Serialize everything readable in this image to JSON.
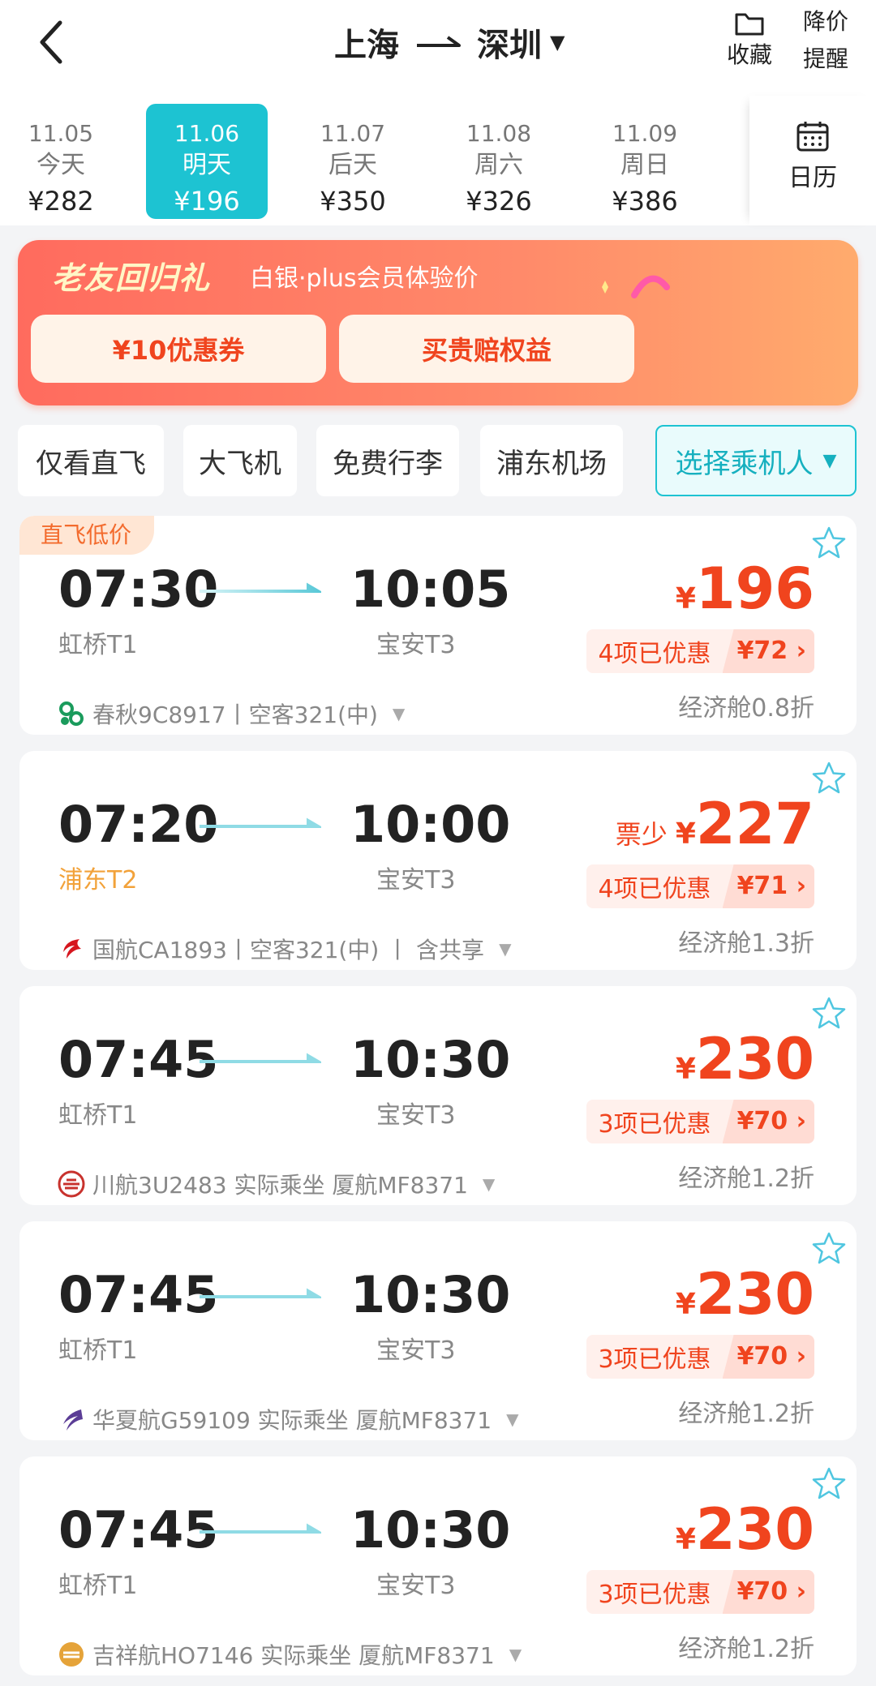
{
  "header": {
    "origin": "上海",
    "destination": "深圳",
    "favorite_label": "收藏",
    "alert_label_line1": "降价",
    "alert_label_line2": "提醒"
  },
  "dates": [
    {
      "date": "11.05",
      "label": "今天",
      "price": "¥282"
    },
    {
      "date": "11.06",
      "label": "明天",
      "price": "¥196"
    },
    {
      "date": "11.07",
      "label": "后天",
      "price": "¥350"
    },
    {
      "date": "11.08",
      "label": "周六",
      "price": "¥326"
    },
    {
      "date": "11.09",
      "label": "周日",
      "price": "¥386"
    }
  ],
  "selected_date_index": 1,
  "calendar_label": "日历",
  "promo": {
    "title": "老友回归礼",
    "subtitle": "白银·plus会员体验价",
    "coupon_label": "¥10优惠券",
    "benefit_label": "买贵赔权益"
  },
  "filters": {
    "nonstop": "仅看直飞",
    "big_plane": "大飞机",
    "free_baggage": "免费行李",
    "pudong": "浦东机场",
    "passenger": "选择乘机人"
  },
  "flights": [
    {
      "tag": "直飞低价",
      "dep_time": "07:30",
      "arr_time": "10:05",
      "dep_airport": "虹桥T1",
      "arr_airport": "宝安T3",
      "airline": "春秋9C8917丨空客321(中)",
      "note": "",
      "yen": "¥",
      "price": "196",
      "discount_label": "4项已优惠",
      "discount_value": "¥72",
      "cabin": "经济舱0.8折"
    },
    {
      "tag": "",
      "dep_time": "07:20",
      "arr_time": "10:00",
      "dep_airport": "浦东T2",
      "arr_airport": "宝安T3",
      "airline": "国航CA1893丨空客321(中) 丨 含共享",
      "note": "票少",
      "yen": "¥",
      "price": "227",
      "discount_label": "4项已优惠",
      "discount_value": "¥71",
      "cabin": "经济舱1.3折"
    },
    {
      "tag": "",
      "dep_time": "07:45",
      "arr_time": "10:30",
      "dep_airport": "虹桥T1",
      "arr_airport": "宝安T3",
      "airline": "川航3U2483 实际乘坐 厦航MF8371",
      "note": "",
      "yen": "¥",
      "price": "230",
      "discount_label": "3项已优惠",
      "discount_value": "¥70",
      "cabin": "经济舱1.2折"
    },
    {
      "tag": "",
      "dep_time": "07:45",
      "arr_time": "10:30",
      "dep_airport": "虹桥T1",
      "arr_airport": "宝安T3",
      "airline": "华夏航G59109 实际乘坐 厦航MF8371",
      "note": "",
      "yen": "¥",
      "price": "230",
      "discount_label": "3项已优惠",
      "discount_value": "¥70",
      "cabin": "经济舱1.2折"
    },
    {
      "tag": "",
      "dep_time": "07:45",
      "arr_time": "10:30",
      "dep_airport": "虹桥T1",
      "arr_airport": "宝安T3",
      "airline": "吉祥航HO7146 实际乘坐 厦航MF8371",
      "note": "",
      "yen": "¥",
      "price": "230",
      "discount_label": "3项已优惠",
      "discount_value": "¥70",
      "cabin": "经济舱1.2折"
    }
  ],
  "colors": {
    "accent": "#1dc3d2",
    "price": "#f0441e",
    "tag_bg": "#ffe6d4"
  }
}
